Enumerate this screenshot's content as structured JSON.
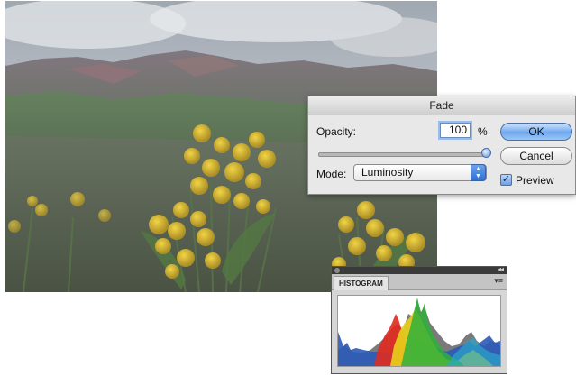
{
  "fade_dialog": {
    "title": "Fade",
    "opacity_label": "Opacity:",
    "opacity_value": "100",
    "opacity_unit": "%",
    "opacity_slider_fraction": 1.0,
    "mode_label": "Mode:",
    "mode_value": "Luminosity",
    "ok_label": "OK",
    "cancel_label": "Cancel",
    "preview_label": "Preview",
    "preview_checked": true
  },
  "histogram_panel": {
    "tab_label": "HISTOGRAM",
    "channel_colors": {
      "blue": "#2a5ab8",
      "red": "#e02a1e",
      "yellow": "#e8d21a",
      "green": "#2fb03a",
      "cyan": "#2aa6c9",
      "gray": "#7a7a7a"
    }
  },
  "icons": {
    "close": "close-icon",
    "collapse": "double-chevron-icon",
    "panel_menu": "panel-menu-icon",
    "select_arrows": "up-down-arrows-icon",
    "check": "checkmark-icon"
  }
}
